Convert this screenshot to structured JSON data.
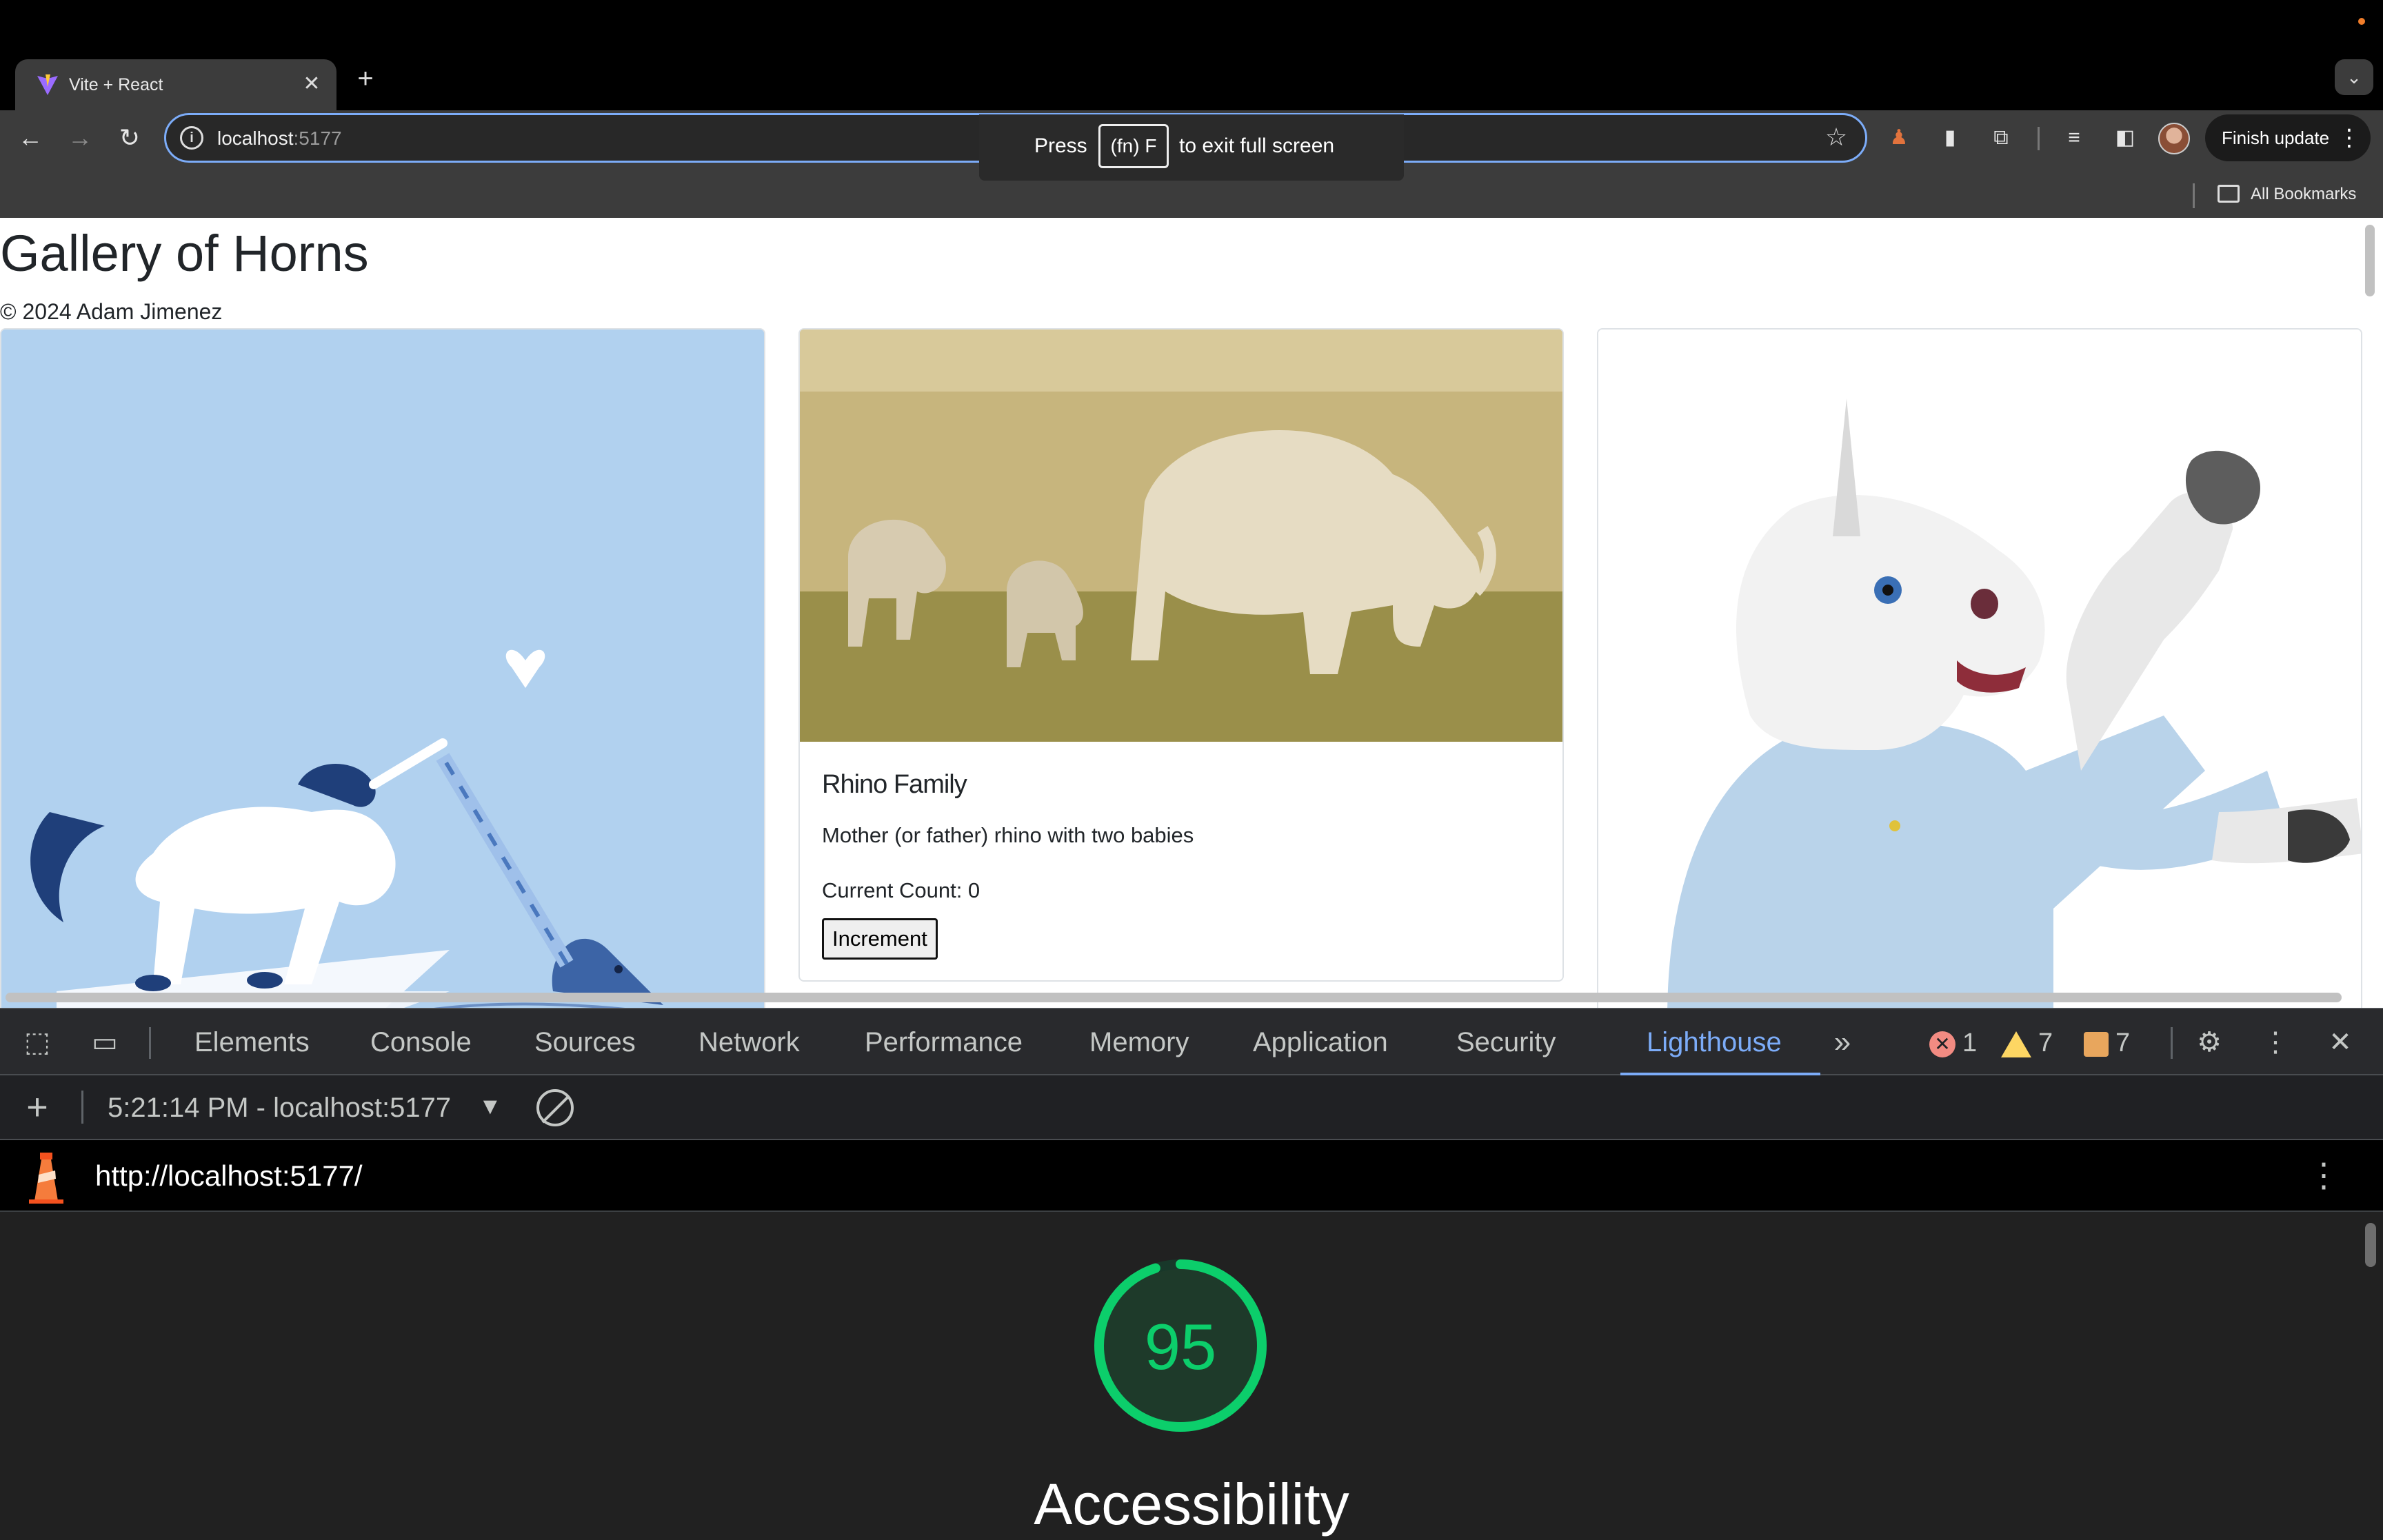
{
  "browser": {
    "tab_title": "Vite + React",
    "url_host": "localhost",
    "url_port": ":5177",
    "finish_update": "Finish update",
    "all_bookmarks": "All Bookmarks",
    "fullscreen_toast": {
      "press": "Press",
      "key": "(fn) F",
      "suffix": "to exit full screen"
    }
  },
  "page": {
    "title": "Gallery of Horns",
    "footer": "© 2024 Adam Jimenez",
    "cards": [
      {
        "image": "unicode-illustration-unicorn-narwhal"
      },
      {
        "image": "rhino-family-photo",
        "title": "Rhino Family",
        "description": "Mother (or father) rhino with two babies",
        "count_label": "Current Count: 0",
        "button_label": "Increment"
      },
      {
        "image": "unicorn-mask-photo"
      }
    ]
  },
  "devtools": {
    "tabs": [
      "Elements",
      "Console",
      "Sources",
      "Network",
      "Performance",
      "Memory",
      "Application",
      "Security",
      "Lighthouse"
    ],
    "active_tab": "Lighthouse",
    "errors": "1",
    "warnings": "7",
    "issues": "7",
    "report_selector": "5:21:14 PM - localhost:5177",
    "report_url": "http://localhost:5177/",
    "score": 95,
    "score_text": "95",
    "category": "Accessibility",
    "colors": {
      "accent": "#7cacf8",
      "score_pass": "#0cce6b"
    }
  }
}
